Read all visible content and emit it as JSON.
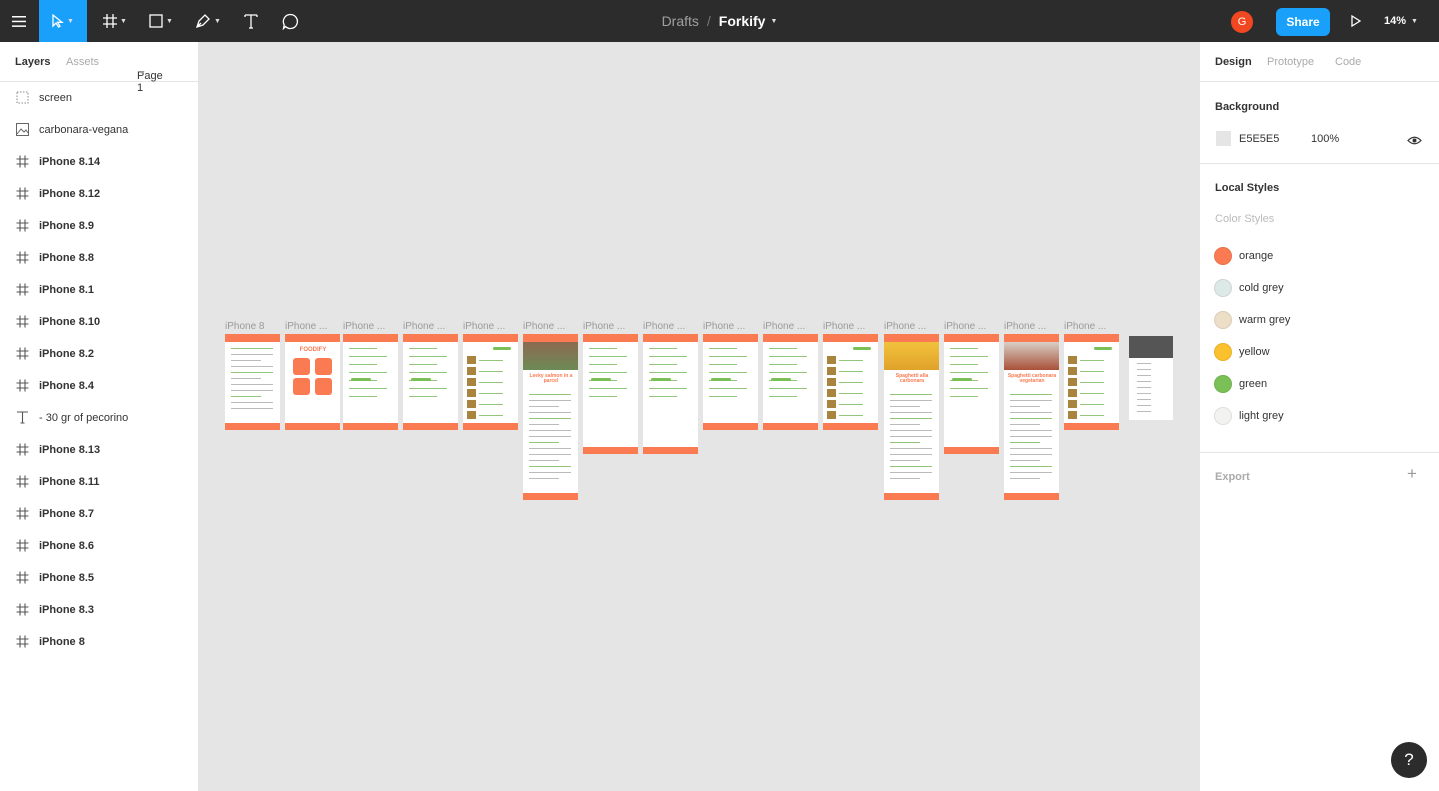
{
  "toolbar": {
    "menu_icon": "hamburger-icon",
    "move_tool": "move-cursor-icon",
    "frame_tool": "hash-frame-icon",
    "shape_tool": "rectangle-icon",
    "pen_tool": "pen-icon",
    "text_tool": "T",
    "comment_tool": "comment-bubble-icon",
    "accent": "#18A0FB"
  },
  "breadcrumb": {
    "folder": "Drafts",
    "separator": "/",
    "file": "Forkify"
  },
  "user": {
    "avatar_initial": "G",
    "avatar_color": "#F24822"
  },
  "share_label": "Share",
  "zoom_label": "14%",
  "left_panel": {
    "tabs": {
      "layers": "Layers",
      "assets": "Assets",
      "page": "Page 1"
    },
    "layers": [
      {
        "name": "screen",
        "type": "group"
      },
      {
        "name": "carbonara-vegana",
        "type": "image"
      },
      {
        "name": "iPhone 8.14",
        "type": "frame"
      },
      {
        "name": "iPhone 8.12",
        "type": "frame"
      },
      {
        "name": "iPhone 8.9",
        "type": "frame"
      },
      {
        "name": "iPhone 8.8",
        "type": "frame"
      },
      {
        "name": "iPhone 8.1",
        "type": "frame"
      },
      {
        "name": "iPhone 8.10",
        "type": "frame"
      },
      {
        "name": "iPhone 8.2",
        "type": "frame"
      },
      {
        "name": "iPhone 8.4",
        "type": "frame"
      },
      {
        "name": "- 30 gr of pecorino",
        "type": "text"
      },
      {
        "name": "iPhone 8.13",
        "type": "frame"
      },
      {
        "name": "iPhone 8.11",
        "type": "frame"
      },
      {
        "name": "iPhone 8.7",
        "type": "frame"
      },
      {
        "name": "iPhone 8.6",
        "type": "frame"
      },
      {
        "name": "iPhone 8.5",
        "type": "frame"
      },
      {
        "name": "iPhone 8.3",
        "type": "frame"
      },
      {
        "name": "iPhone 8",
        "type": "frame"
      }
    ]
  },
  "canvas": {
    "background": "#E5E5E5",
    "frame_labels": [
      "iPhone 8",
      "iPhone ...",
      "iPhone ...",
      "iPhone ...",
      "iPhone ...",
      "iPhone ...",
      "iPhone ...",
      "iPhone ...",
      "iPhone ...",
      "iPhone ...",
      "iPhone ...",
      "iPhone ...",
      "iPhone ...",
      "iPhone ...",
      "iPhone ..."
    ],
    "frame_texts": {
      "foodify": "FOODIFY",
      "salmon": "Leeky salmon in a parcel",
      "spaghetti": "Spaghetti alla carbonara",
      "vegetarian": "Spaghetti carbonara vegetarian"
    }
  },
  "right_panel": {
    "tabs": {
      "design": "Design",
      "prototype": "Prototype",
      "code": "Code"
    },
    "background": {
      "title": "Background",
      "hex": "E5E5E5",
      "opacity": "100%",
      "eye_icon": "eye-icon"
    },
    "local_styles": {
      "title": "Local Styles",
      "subtitle": "Color Styles",
      "colors": [
        {
          "name": "orange",
          "hex": "#FA7B52"
        },
        {
          "name": "cold grey",
          "hex": "#DDE9E6"
        },
        {
          "name": "warm grey",
          "hex": "#EDDFC7"
        },
        {
          "name": "yellow",
          "hex": "#FBC02D"
        },
        {
          "name": "green",
          "hex": "#7AC056"
        },
        {
          "name": "light grey",
          "hex": "#F2F2EE"
        }
      ]
    },
    "export": {
      "title": "Export",
      "add_icon": "plus-icon"
    }
  },
  "help_label": "?"
}
